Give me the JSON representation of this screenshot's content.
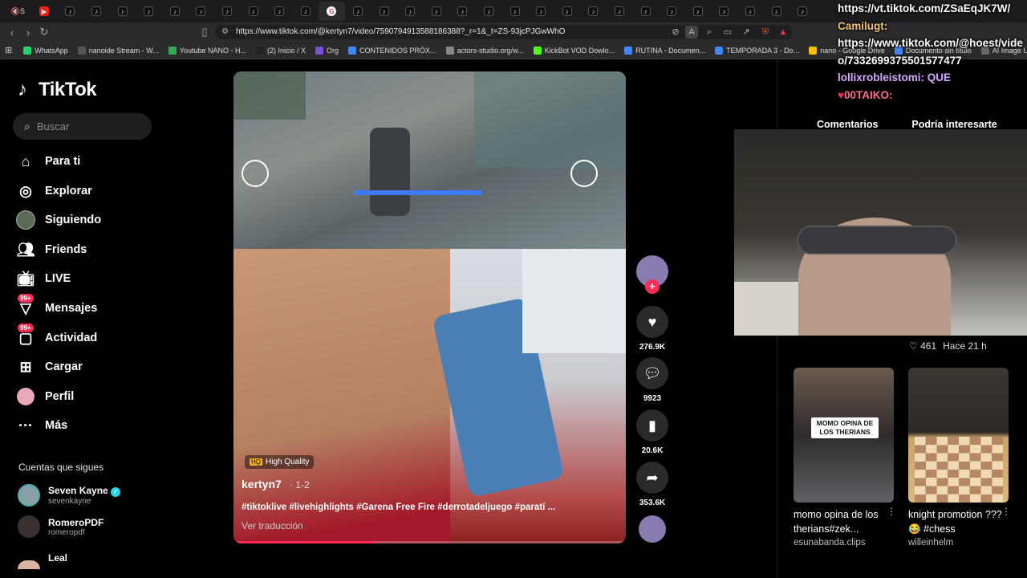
{
  "browser": {
    "url": "https://www.tiktok.com/@kertyn7/video/7590794913588186388?_r=1&_t=ZS-93jcPJGwWhO",
    "bookmarks": [
      {
        "label": "WhatsApp",
        "color": "#25d366"
      },
      {
        "label": "nanoide Stream - W...",
        "color": "#555"
      },
      {
        "label": "Youtube NANO - H...",
        "color": "#35a853"
      },
      {
        "label": "(2) Inicio / X",
        "color": "#222"
      },
      {
        "label": "Org",
        "color": "#7a4fd0"
      },
      {
        "label": "CONTENIDOS PRÓX...",
        "color": "#4285f4"
      },
      {
        "label": "actors-studio.org/w...",
        "color": "#888"
      },
      {
        "label": "KickBot VOD Dowlo...",
        "color": "#53fc18"
      },
      {
        "label": "RUTINA - Documen...",
        "color": "#4285f4"
      },
      {
        "label": "TEMPORADA 3 - Do...",
        "color": "#4285f4"
      },
      {
        "label": "nano - Google Drive",
        "color": "#fbbc04"
      },
      {
        "label": "Documento sin título",
        "color": "#4285f4"
      },
      {
        "label": "AI Image Upscaler |...",
        "color": "#666"
      }
    ]
  },
  "sidebar": {
    "brand": "TikTok",
    "search_placeholder": "Buscar",
    "items": [
      {
        "label": "Para ti",
        "icon": "home-icon"
      },
      {
        "label": "Explorar",
        "icon": "compass-icon"
      },
      {
        "label": "Siguiendo",
        "icon": "following-avatar"
      },
      {
        "label": "Friends",
        "icon": "friends-icon"
      },
      {
        "label": "LIVE",
        "icon": "live-icon"
      },
      {
        "label": "Mensajes",
        "icon": "inbox-icon",
        "badge": "99+"
      },
      {
        "label": "Actividad",
        "icon": "activity-icon",
        "badge": "99+"
      },
      {
        "label": "Cargar",
        "icon": "upload-icon"
      },
      {
        "label": "Perfil",
        "icon": "profile-avatar"
      },
      {
        "label": "Más",
        "icon": "more-icon"
      }
    ],
    "following_header": "Cuentas que sigues",
    "following": [
      {
        "name": "Seven Kayne",
        "user": "sevenkayne",
        "verified": true
      },
      {
        "name": "RomeroPDF",
        "user": "romeropdf"
      },
      {
        "name": "Leal",
        "user": ""
      }
    ]
  },
  "video": {
    "quality_badge": "High Quality",
    "author": "kertyn7",
    "date": "· 1-2",
    "description": "#tiktoklive #livehighlights #Garena Free Fire #derrotadeljuego #paratí ...",
    "translate": "Ver traducción",
    "progress": 0.36
  },
  "actions": {
    "likes": "276.9K",
    "comments": "9923",
    "saves": "20.6K",
    "shares": "353.6K"
  },
  "right_panel": {
    "tabs": [
      "Comentarios",
      "Podría interesarte"
    ],
    "comment_meta": {
      "likes": "461",
      "time": "Hace 21 h"
    },
    "cards": [
      {
        "title": "momo opina de los therians#zek...",
        "channel": "esunabanda.clips",
        "thumb_text": "MOMO OPINA DE LOS THERIANS"
      },
      {
        "title": "knight promotion ???😂 #chess",
        "channel": "willeinhelm"
      }
    ]
  },
  "chat_overlay": {
    "lines": [
      {
        "text": "https://vt.tiktok.com/ZSaEqJK7W/",
        "type": "msg"
      },
      {
        "text": "Camilugt:",
        "type": "user"
      },
      {
        "text": "https://www.tiktok.com/@hoest/video/7332699375501577477",
        "type": "msg"
      },
      {
        "text": "lollixrobleistomi: QUE",
        "type": "user2"
      },
      {
        "text": "00TAIKO:",
        "type": "user3"
      }
    ]
  },
  "colors": {
    "accent": "#fe2c55",
    "background": "#000000"
  }
}
